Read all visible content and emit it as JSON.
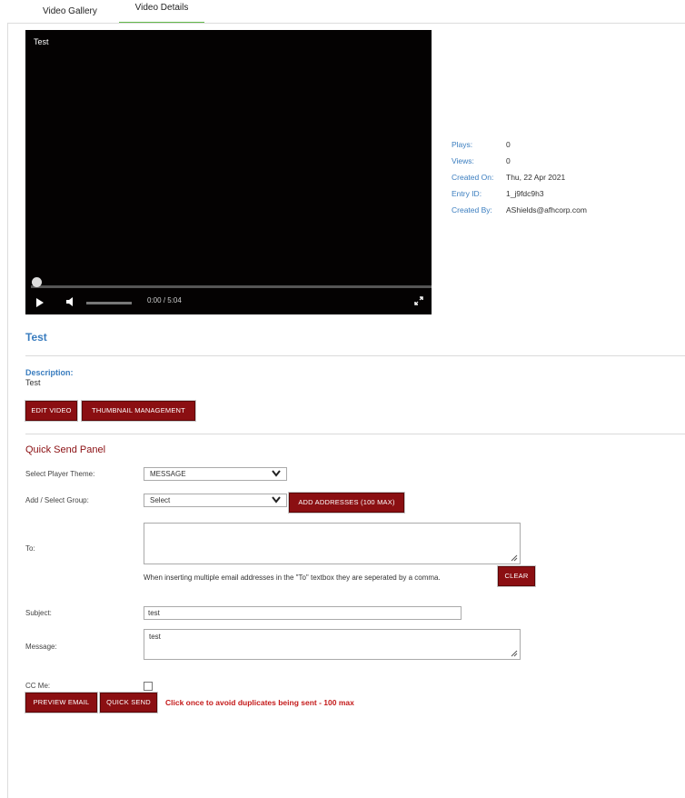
{
  "tabs": [
    {
      "label": "Video Gallery"
    },
    {
      "label": "Video Details"
    }
  ],
  "player": {
    "title": "Test",
    "current_time": "0:00",
    "duration": "/ 5:04",
    "progress": 0
  },
  "meta": [
    {
      "key": "Plays:",
      "value": "0"
    },
    {
      "key": "Views:",
      "value": "0"
    },
    {
      "key": "Created On:",
      "value": "Thu, 22 Apr 2021"
    },
    {
      "key": "Entry ID:",
      "value": "1_j9fdc9h3"
    },
    {
      "key": "Created By:",
      "value": "AShields@afhcorp.com"
    }
  ],
  "video": {
    "title": "Test",
    "description_label": "Description:",
    "description": "Test"
  },
  "buttons": {
    "edit_video": "EDIT VIDEO",
    "thumbnail_management": "THUMBNAIL MANAGEMENT",
    "add_addresses": "ADD ADDRESSES (100 MAX)",
    "clear": "CLEAR",
    "preview_email": "PREVIEW EMAIL",
    "quick_send": "QUICK SEND"
  },
  "quick_send": {
    "title": "Quick Send Panel",
    "player_theme_label": "Select Player Theme:",
    "player_theme_value": "MESSAGE",
    "group_label": "Add / Select Group:",
    "group_value": "Select",
    "to_label": "To:",
    "to_value": "",
    "hint": "When inserting multiple email addresses in the \"To\" textbox they are seperated by a comma.",
    "subject_label": "Subject:",
    "subject_value": "test",
    "message_label": "Message:",
    "message_value": "test",
    "cc_label": "CC Me:",
    "cc_checked": false,
    "warning": "Click once to avoid duplicates being sent - 100 max"
  },
  "colors": {
    "accent_blue": "#3a7dbf",
    "button_red": "#8b0f12",
    "tab_active": "#62b94a",
    "warning_red": "#c41a1a"
  }
}
